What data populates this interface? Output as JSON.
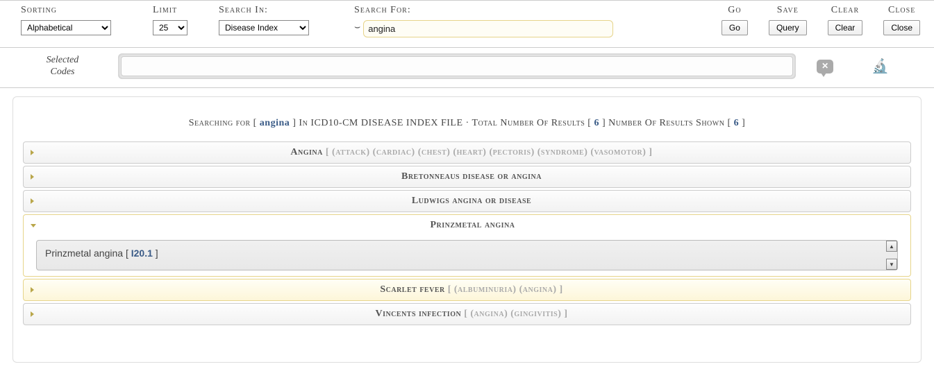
{
  "toolbar": {
    "sorting": {
      "label": "Sorting",
      "value": "Alphabetical",
      "options": [
        "Alphabetical"
      ]
    },
    "limit": {
      "label": "Limit",
      "value": "25",
      "options": [
        "25"
      ]
    },
    "search_in": {
      "label": "Search In:",
      "value": "Disease Index",
      "options": [
        "Disease Index"
      ]
    },
    "search_for": {
      "label": "Search For:",
      "value": "angina"
    },
    "actions": {
      "go": {
        "label": "Go",
        "button": "Go"
      },
      "save": {
        "label": "Save",
        "button": "Query"
      },
      "clear": {
        "label": "Clear",
        "button": "Clear"
      },
      "close": {
        "label": "Close",
        "button": "Close"
      }
    }
  },
  "selected_codes": {
    "label_line1": "Selected",
    "label_line2": "Codes",
    "value": ""
  },
  "results": {
    "header": {
      "pre": "Searching for [ ",
      "keyword": "angina",
      "mid1": " ] In ",
      "file": "ICD10-CM DISEASE INDEX FILE",
      "mid2": " · Total Number Of Results [ ",
      "total": "6",
      "mid3": " ] Number Of Results Shown [ ",
      "shown": "6",
      "post": " ]"
    },
    "items": [
      {
        "title": "Angina",
        "qualifiers": "[ (attack) (cardiac) (chest) (heart) (pectoris) (syndrome) (vasomotor) ]",
        "expanded": false
      },
      {
        "title": "Bretonneaus disease or angina",
        "qualifiers": "",
        "expanded": false
      },
      {
        "title": "Ludwigs angina or disease",
        "qualifiers": "",
        "expanded": false
      },
      {
        "title": "Prinzmetal angina",
        "qualifiers": "",
        "expanded": true,
        "body_text": "Prinzmetal angina",
        "body_code": "I20.1"
      },
      {
        "title": "Scarlet fever",
        "qualifiers": "[ (albuminuria) (angina) ]",
        "expanded": false,
        "highlighted": true
      },
      {
        "title": "Vincents infection",
        "qualifiers": "[ (angina) (gingivitis) ]",
        "expanded": false
      }
    ]
  }
}
